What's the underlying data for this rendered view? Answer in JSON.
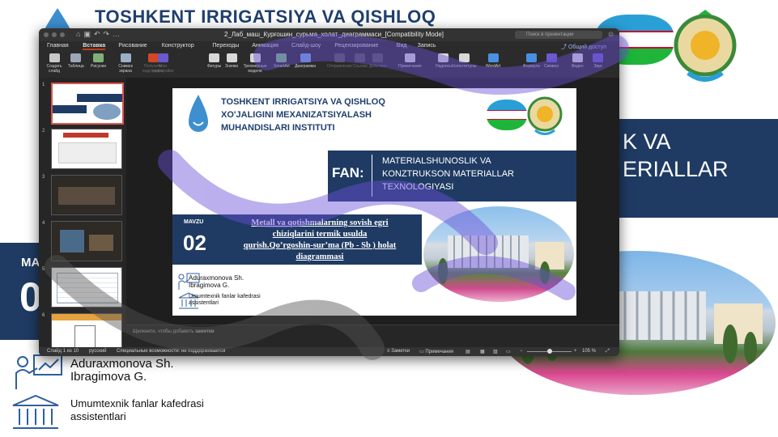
{
  "background_slide": {
    "title": "TOSHKENT IRRIGATSIYA VA QISHLOQ",
    "fan_line1": "K  VA",
    "fan_line2": "ERIALLAR",
    "mavzu_label": "MA",
    "number": "0",
    "author_line1": "Aduraxmonova Sh.",
    "author_line2": "Ibragimova G.",
    "dept_line1": "Umumtexnik fanlar kafedrasi",
    "dept_line2": "assistentlari"
  },
  "window": {
    "title": "2_Лаб_маш_Курғошин_сурьма_холат_диаграммаси_[Compatibility Mode]",
    "search_placeholder": "Поиск в презентации",
    "share_label": "Общий доступ"
  },
  "tabs": [
    "Главная",
    "Вставка",
    "Рисование",
    "Конструктор",
    "Переходы",
    "Анимация",
    "Слайд-шоу",
    "Рецензирование",
    "Вид",
    "Запись"
  ],
  "active_tab": "Вставка",
  "ribbon": [
    {
      "label": "Создать слайд",
      "icon": "new-slide-icon",
      "color": "#c8c8c8",
      "dim": false
    },
    {
      "label": "Таблица",
      "icon": "table-icon",
      "color": "#9aa7b8",
      "dim": false
    },
    {
      "label": "Рисунки",
      "icon": "pictures-icon",
      "color": "#7fb07a",
      "dim": false
    },
    {
      "label": "Снимок экрана",
      "icon": "screenshot-icon",
      "color": "#9ab0c8",
      "dim": false
    },
    {
      "label": "Получить надстройки",
      "icon": "store-icon",
      "color": "#d24726",
      "dim": true
    },
    {
      "label": "Мои надстройки",
      "icon": "addins-icon",
      "color": "#6a5acd",
      "dim": true
    },
    {
      "label": "Фигуры",
      "icon": "shapes-icon",
      "color": "#d8d8d8",
      "dim": false
    },
    {
      "label": "Значки",
      "icon": "icons-icon",
      "color": "#d8d8d8",
      "dim": false
    },
    {
      "label": "Трехмерные модели",
      "icon": "3d-models-icon",
      "color": "#d8d8d8",
      "dim": false
    },
    {
      "label": "SmartArt",
      "icon": "smartart-icon",
      "color": "#7ec07a",
      "dim": false
    },
    {
      "label": "Диаграмма",
      "icon": "chart-icon",
      "color": "#6fa8dc",
      "dim": false
    },
    {
      "label": "Отправление",
      "icon": "send-icon",
      "color": "#555555",
      "dim": true
    },
    {
      "label": "Ссылка",
      "icon": "link-icon",
      "color": "#555555",
      "dim": true
    },
    {
      "label": "Действие",
      "icon": "action-icon",
      "color": "#555555",
      "dim": true
    },
    {
      "label": "Примечание",
      "icon": "comment-icon",
      "color": "#d8d8d8",
      "dim": false
    },
    {
      "label": "Надпись",
      "icon": "textbox-icon",
      "color": "#d8d8d8",
      "dim": false
    },
    {
      "label": "Колонтитулы",
      "icon": "header-footer-icon",
      "color": "#d8d8d8",
      "dim": false
    },
    {
      "label": "WordArt",
      "icon": "wordart-icon",
      "color": "#4a90e2",
      "dim": false
    },
    {
      "label": "Формула",
      "icon": "equation-icon",
      "color": "#4a90e2",
      "dim": false
    },
    {
      "label": "Символ",
      "icon": "symbol-icon",
      "color": "#6a5acd",
      "dim": false
    },
    {
      "label": "Видео",
      "icon": "video-icon",
      "color": "#d8d8d8",
      "dim": false
    },
    {
      "label": "Звук",
      "icon": "audio-icon",
      "color": "#6a5acd",
      "dim": false
    }
  ],
  "thumbnails": [
    "1",
    "2",
    "3",
    "4",
    "5",
    "6"
  ],
  "selected_thumbnail": "1",
  "notes_placeholder_prefix": "Щелкните, чтобы добавить",
  "notes_placeholder_bold": "заметки",
  "status": {
    "slide_info": "Слайд 1 из 10",
    "language": "русский",
    "accessibility": "Специальные возможности: не поддерживается",
    "notes_btn": "Заметки",
    "comments_btn": "Примечания",
    "zoom": "105 %"
  },
  "slide": {
    "title_line1": "TOSHKENT IRRIGATSIYA VA QISHLOQ",
    "title_line2": "XO'JALIGINI MEXANIZATSIYALASH",
    "title_line3": "MUHANDISLARI INSTITUTI",
    "fan_label": "FAN:",
    "fan_line1": "MATERIALSHUNOSLIK  VA",
    "fan_line2": "KONZTRUKSON MATERIALLAR",
    "fan_line3": "TEXNOLOGIYASI",
    "mavzu_label": "MAVZU",
    "number": "02",
    "topic_line1": "Metall va qotishmalarning sovish egri",
    "topic_line2": "chiziqlarini termik  usulda",
    "topic_line3": "qurish.Qo’rgoshin-sur’ma  (Pb  - Sb ) holat",
    "topic_line4": "diagrammasi",
    "author_line1": "Aduraxmonova Sh.",
    "author_line2": "Ibragimova G.",
    "dept_line1": "Umumtexnik fanlar kafedrasi",
    "dept_line2": "assistentlari"
  },
  "colors": {
    "navy": "#1f3b63",
    "title_blue": "#1f3f6e",
    "accent_red": "#c43e1c",
    "flag_blue": "#2a9fd6",
    "flag_green": "#1eb53a"
  }
}
